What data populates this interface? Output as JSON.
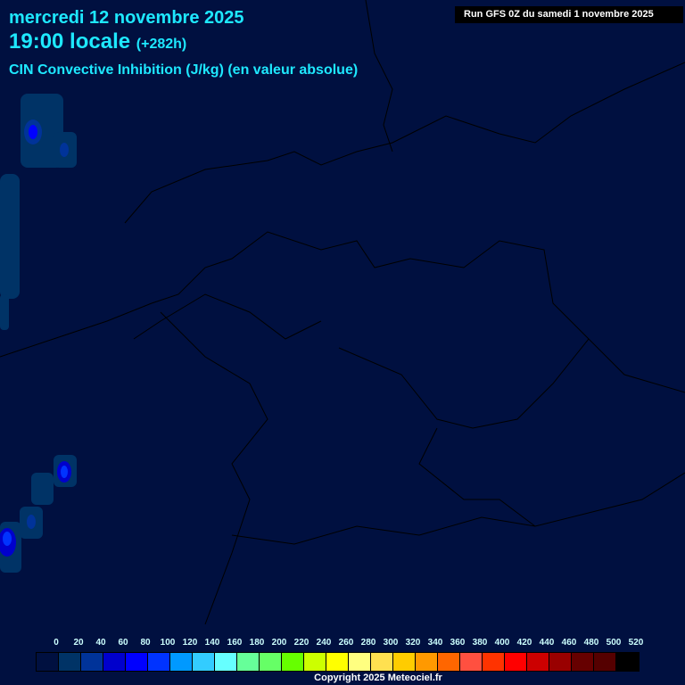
{
  "header": {
    "date": "mercredi 12 novembre 2025",
    "time": "19:00 locale",
    "offset": "(+282h)",
    "parameter": "CIN Convective Inhibition (J/kg) (en valeur absolue)"
  },
  "run_info": "Run GFS 0Z du samedi 1 novembre 2025",
  "legend": {
    "labels": [
      "0",
      "20",
      "40",
      "60",
      "80",
      "100",
      "120",
      "140",
      "160",
      "180",
      "200",
      "220",
      "240",
      "260",
      "280",
      "300",
      "320",
      "340",
      "360",
      "380",
      "400",
      "420",
      "440",
      "460",
      "480",
      "500",
      "520"
    ],
    "colors": [
      "#001040",
      "#003366",
      "#003399",
      "#0000cc",
      "#0000ff",
      "#0033ff",
      "#0099ff",
      "#33ccff",
      "#66ffff",
      "#66ff99",
      "#66ff66",
      "#66ff00",
      "#ccff00",
      "#ffff00",
      "#ffff80",
      "#ffe050",
      "#ffcc00",
      "#ff9900",
      "#ff6600",
      "#ff5040",
      "#ff3300",
      "#ff0000",
      "#cc0000",
      "#990000",
      "#660000",
      "#550000",
      "#000000"
    ]
  },
  "copyright": "Copyright 2025 Meteociel.fr"
}
